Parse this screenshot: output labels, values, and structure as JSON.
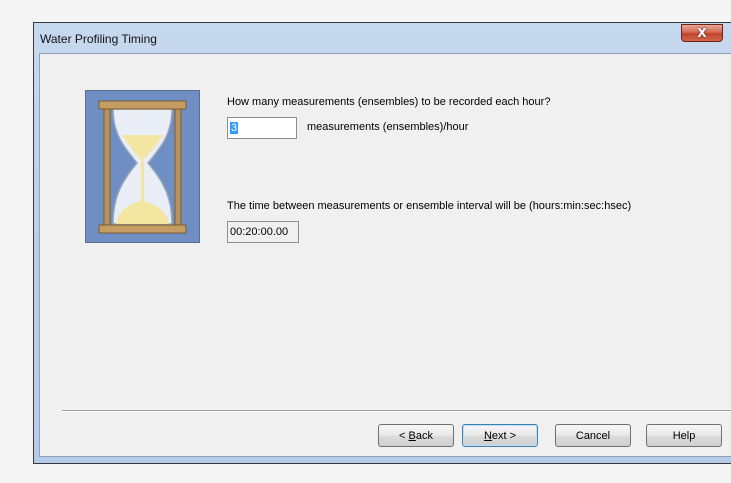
{
  "window": {
    "title": "Water Profiling Timing",
    "close_glyph": "X"
  },
  "measurements": {
    "question": "How many measurements (ensembles) to be recorded each hour?",
    "value": "3",
    "unit_label": "measurements (ensembles)/hour"
  },
  "interval": {
    "label": "The time between measurements or ensemble interval will be (hours:min:sec:hsec)",
    "value": "00:20:00.00"
  },
  "buttons": {
    "back": {
      "prefix": "< ",
      "accel": "B",
      "rest": "ack"
    },
    "next": {
      "accel": "N",
      "rest": "ext >"
    },
    "cancel": "Cancel",
    "help": "Help"
  },
  "icon": "hourglass-icon",
  "colors": {
    "icon_background": "#6f8fc4",
    "hourglass_frame": "#b8925a",
    "sand": "#f2e6a0",
    "selection": "#3399ff",
    "close_button": "#c7432c"
  }
}
